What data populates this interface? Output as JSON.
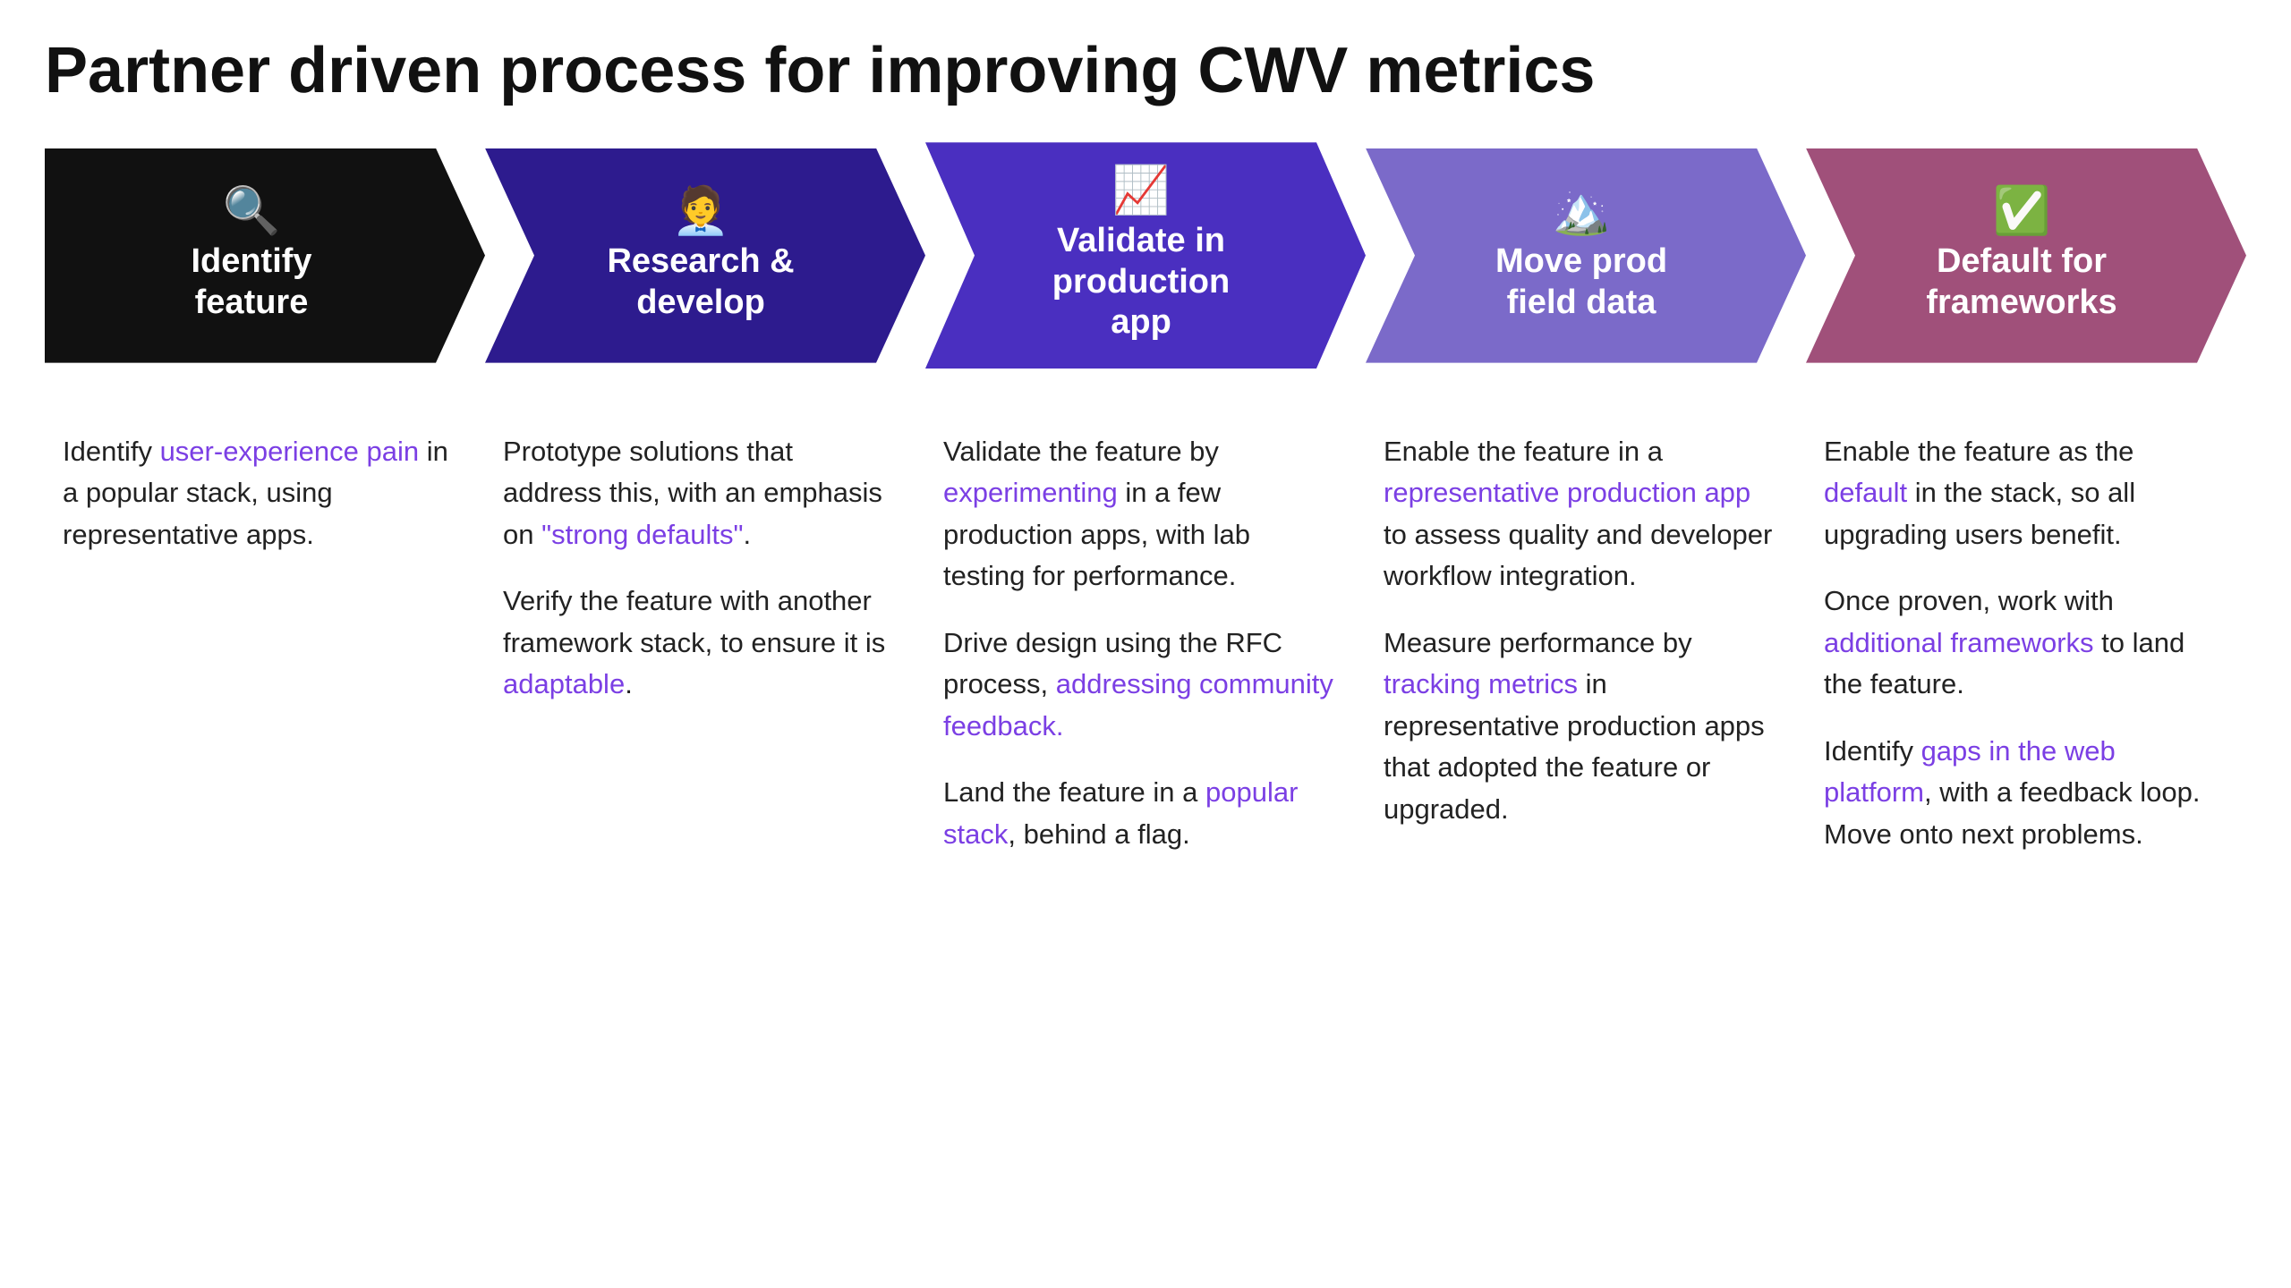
{
  "page": {
    "title": "Partner driven process for improving CWV metrics"
  },
  "arrows": [
    {
      "id": "identify",
      "icon": "🔍",
      "title": "Identify\nfeature",
      "colorClass": "c1",
      "first": true
    },
    {
      "id": "research",
      "icon": "🧑‍💼",
      "title": "Research &\ndevelop",
      "colorClass": "c2",
      "first": false
    },
    {
      "id": "validate",
      "icon": "📈",
      "title": "Validate in\nproduction\napp",
      "colorClass": "c3",
      "first": false
    },
    {
      "id": "move",
      "icon": "🏔️",
      "title": "Move prod\nfield data",
      "colorClass": "c4",
      "first": false
    },
    {
      "id": "default",
      "icon": "✅",
      "title": "Default for\nframeworks",
      "colorClass": "c5",
      "first": false
    }
  ],
  "columns": [
    {
      "paragraphs": [
        {
          "parts": [
            {
              "text": "Identify ",
              "style": "normal"
            },
            {
              "text": "user-experience pain",
              "style": "link-purple"
            },
            {
              "text": " in a popular stack, using representative apps.",
              "style": "normal"
            }
          ]
        }
      ]
    },
    {
      "paragraphs": [
        {
          "parts": [
            {
              "text": "Prototype solutions that address this, with an emphasis on ",
              "style": "normal"
            },
            {
              "text": "\"strong defaults\"",
              "style": "link-purple"
            },
            {
              "text": ".",
              "style": "normal"
            }
          ]
        },
        {
          "parts": [
            {
              "text": "Verify the feature with another framework stack, to ensure it is ",
              "style": "normal"
            },
            {
              "text": "adaptable",
              "style": "link-purple"
            },
            {
              "text": ".",
              "style": "normal"
            }
          ]
        }
      ]
    },
    {
      "paragraphs": [
        {
          "parts": [
            {
              "text": "Validate the feature by ",
              "style": "normal"
            },
            {
              "text": "experimenting",
              "style": "link-purple"
            },
            {
              "text": " in a few production apps, with lab testing for performance.",
              "style": "normal"
            }
          ]
        },
        {
          "parts": [
            {
              "text": "Drive design using the RFC process, ",
              "style": "normal"
            },
            {
              "text": "addressing community feedback.",
              "style": "link-purple"
            }
          ]
        },
        {
          "parts": [
            {
              "text": "Land the feature in a ",
              "style": "normal"
            },
            {
              "text": "popular stack",
              "style": "link-purple"
            },
            {
              "text": ", behind a flag.",
              "style": "normal"
            }
          ]
        }
      ]
    },
    {
      "paragraphs": [
        {
          "parts": [
            {
              "text": "Enable the feature in a ",
              "style": "normal"
            },
            {
              "text": "representative production app",
              "style": "link-purple"
            },
            {
              "text": " to assess quality and developer workflow integration.",
              "style": "normal"
            }
          ]
        },
        {
          "parts": [
            {
              "text": "Measure performance by ",
              "style": "normal"
            },
            {
              "text": "tracking metrics",
              "style": "link-purple"
            },
            {
              "text": " in representative production apps that adopted the feature or upgraded.",
              "style": "normal"
            }
          ]
        }
      ]
    },
    {
      "paragraphs": [
        {
          "parts": [
            {
              "text": "Enable the feature as the ",
              "style": "normal"
            },
            {
              "text": "default",
              "style": "link-purple"
            },
            {
              "text": " in the stack, so all upgrading users benefit.",
              "style": "normal"
            }
          ]
        },
        {
          "parts": [
            {
              "text": "Once proven, work with ",
              "style": "normal"
            },
            {
              "text": "additional frameworks",
              "style": "link-purple"
            },
            {
              "text": " to land the feature.",
              "style": "normal"
            }
          ]
        },
        {
          "parts": [
            {
              "text": "Identify ",
              "style": "normal"
            },
            {
              "text": "gaps in the web platform",
              "style": "link-purple"
            },
            {
              "text": ", with a feedback loop. Move onto next problems.",
              "style": "normal"
            }
          ]
        }
      ]
    }
  ]
}
